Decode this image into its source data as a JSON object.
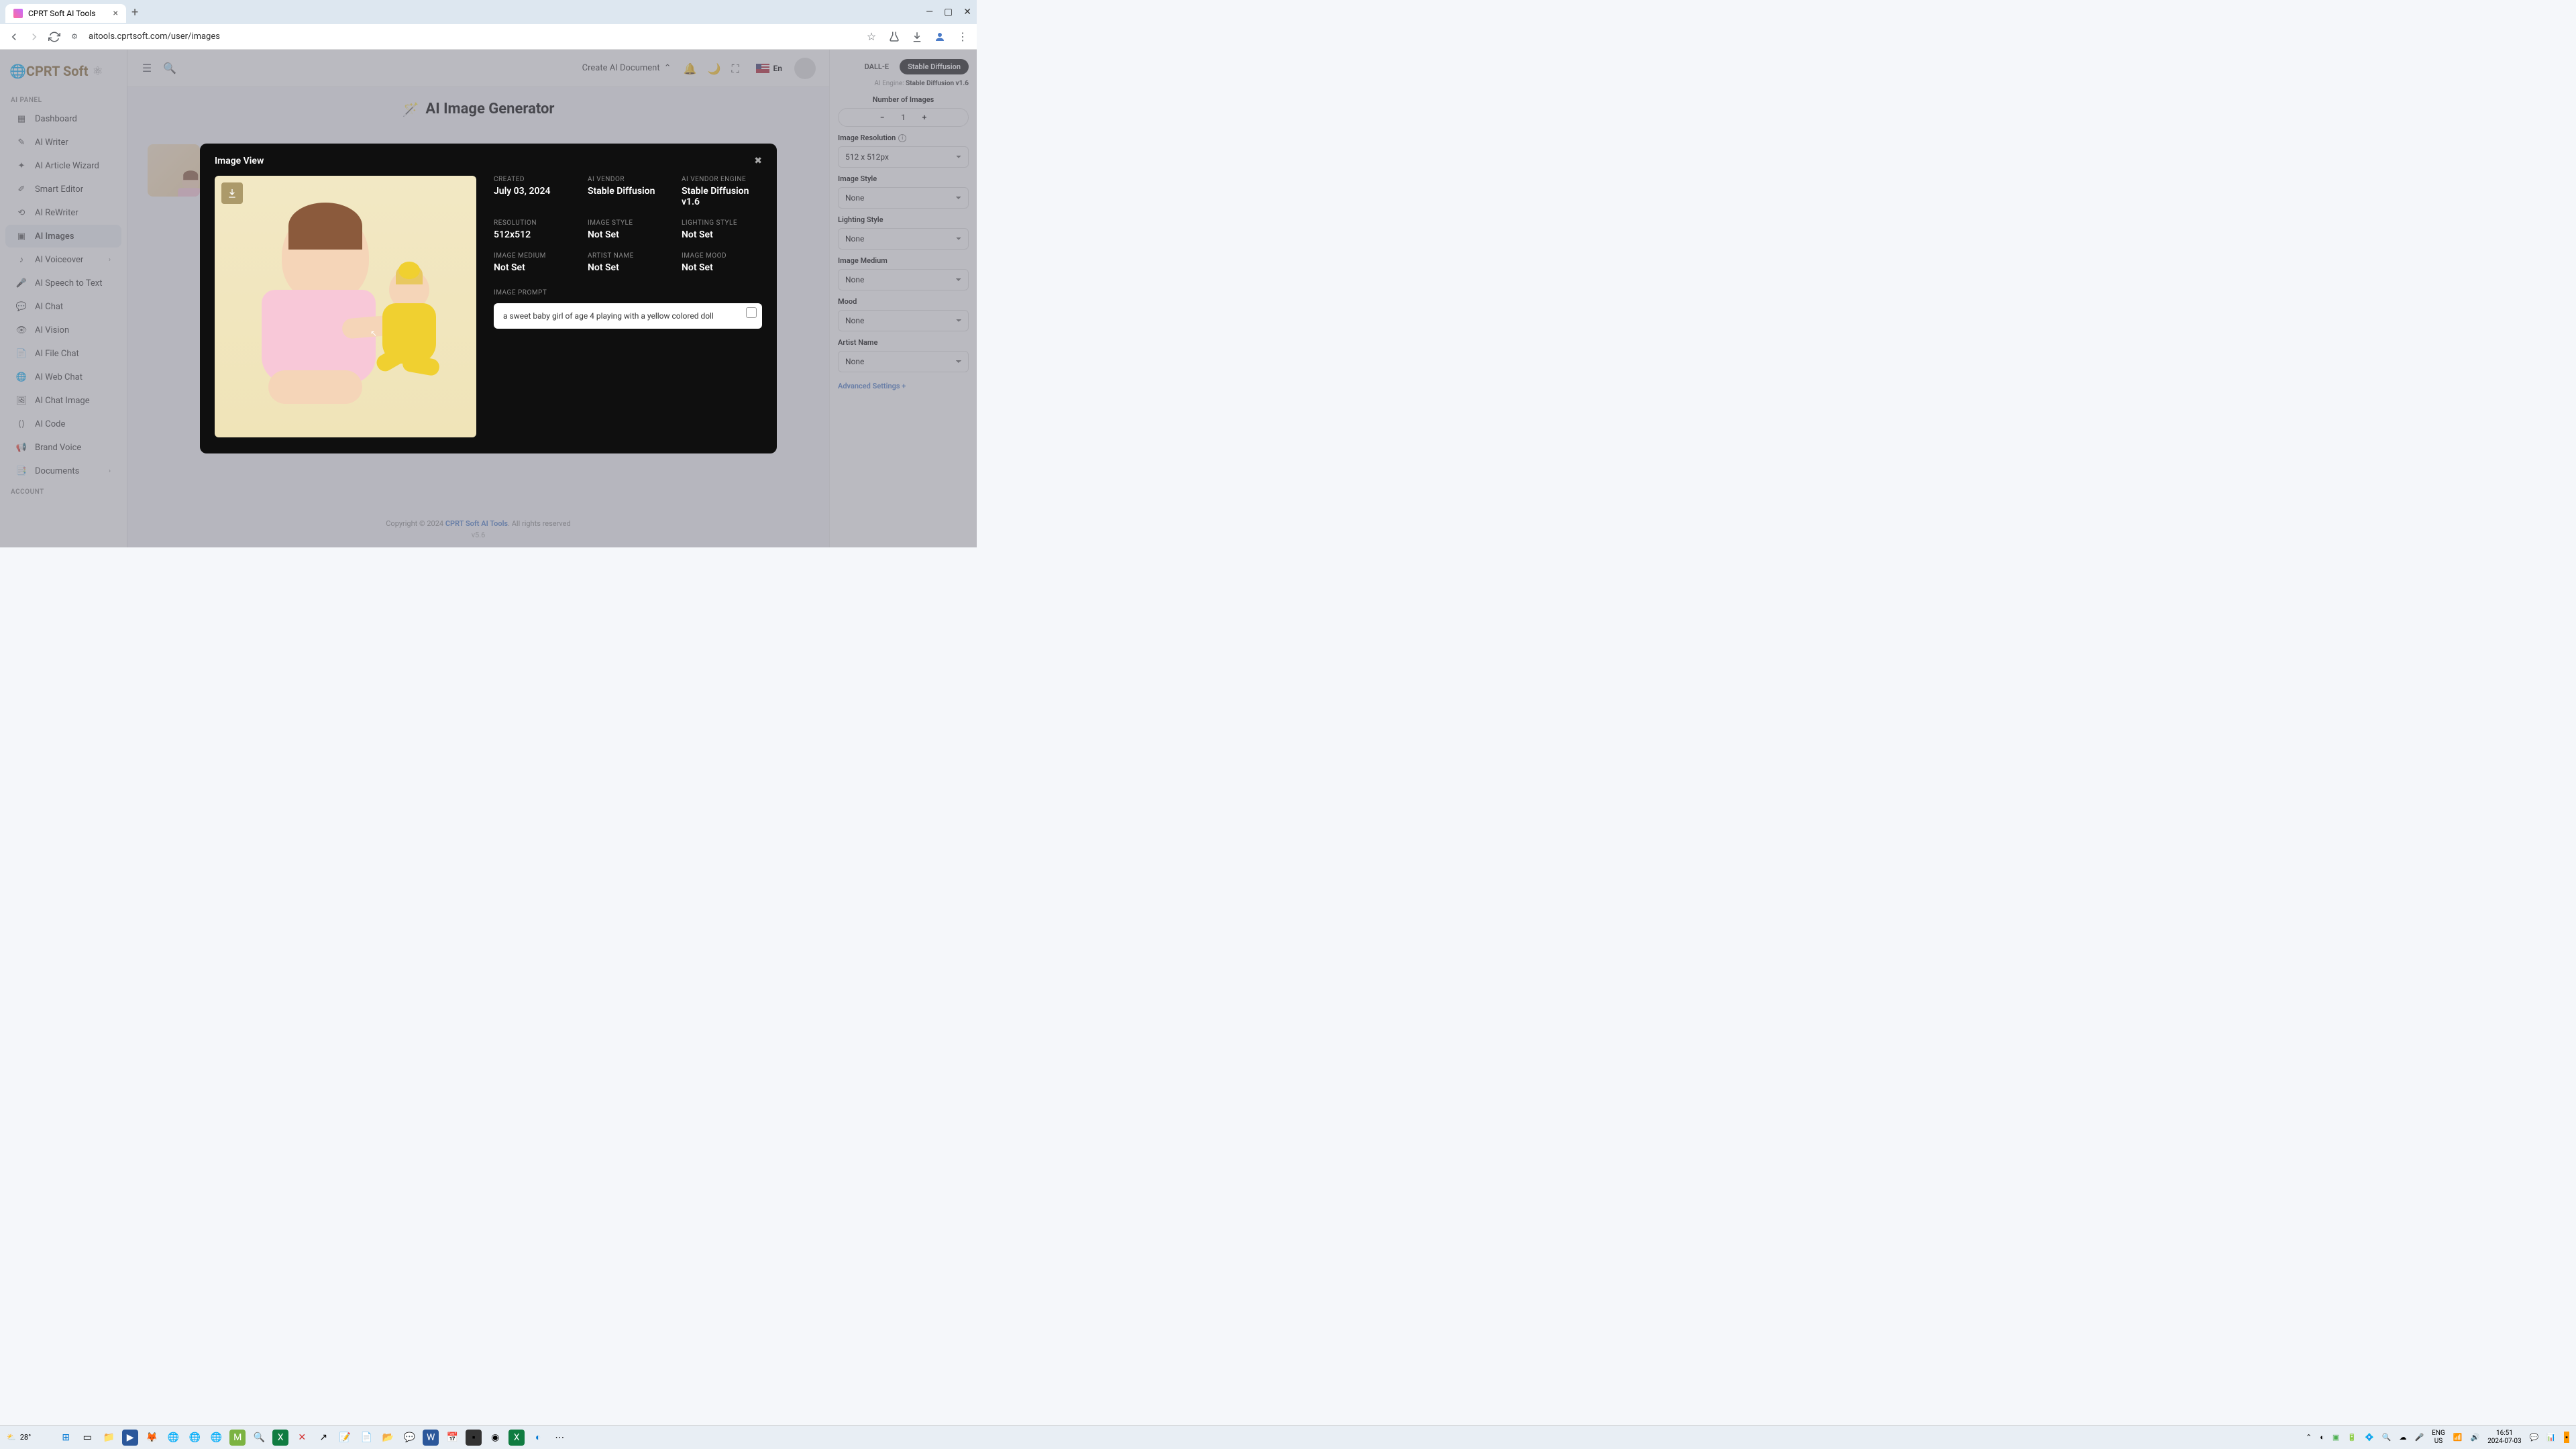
{
  "browser": {
    "tab_title": "CPRT Soft AI Tools",
    "url": "aitools.cprtsoft.com/user/images"
  },
  "logo_text": "CPRT Soft",
  "topbar": {
    "create_doc": "Create AI Document",
    "lang": "En"
  },
  "sidebar": {
    "section_ai": "AI PANEL",
    "section_account": "ACCOUNT",
    "items": [
      {
        "label": "Dashboard"
      },
      {
        "label": "AI Writer"
      },
      {
        "label": "AI Article Wizard"
      },
      {
        "label": "Smart Editor"
      },
      {
        "label": "AI ReWriter"
      },
      {
        "label": "AI Images"
      },
      {
        "label": "AI Voiceover"
      },
      {
        "label": "AI Speech to Text"
      },
      {
        "label": "AI Chat"
      },
      {
        "label": "AI Vision"
      },
      {
        "label": "AI File Chat"
      },
      {
        "label": "AI Web Chat"
      },
      {
        "label": "AI Chat Image"
      },
      {
        "label": "AI Code"
      },
      {
        "label": "Brand Voice"
      },
      {
        "label": "Documents"
      }
    ]
  },
  "page": {
    "title": "AI Image Generator"
  },
  "right": {
    "tab_dalle": "DALL-E",
    "tab_sd": "Stable Diffusion",
    "engine_prefix": "AI Engine: ",
    "engine_value": "Stable Diffusion v1.6",
    "num_label": "Number of Images",
    "num_value": "1",
    "res_label": "Image Resolution",
    "res_value": "512 x 512px",
    "style_label": "Image Style",
    "style_value": "None",
    "light_label": "Lighting Style",
    "light_value": "None",
    "medium_label": "Image Medium",
    "medium_value": "None",
    "mood_label": "Mood",
    "mood_value": "None",
    "artist_label": "Artist Name",
    "artist_value": "None",
    "adv": "Advanced Settings +"
  },
  "modal": {
    "title": "Image View",
    "meta": {
      "created_l": "CREATED",
      "created_v": "July 03, 2024",
      "vendor_l": "AI VENDOR",
      "vendor_v": "Stable Diffusion",
      "engine_l": "AI VENDOR ENGINE",
      "engine_v": "Stable Diffusion v1.6",
      "res_l": "RESOLUTION",
      "res_v": "512x512",
      "style_l": "IMAGE STYLE",
      "style_v": "Not Set",
      "light_l": "LIGHTING STYLE",
      "light_v": "Not Set",
      "medium_l": "IMAGE MEDIUM",
      "medium_v": "Not Set",
      "artist_l": "ARTIST NAME",
      "artist_v": "Not Set",
      "mood_l": "IMAGE MOOD",
      "mood_v": "Not Set"
    },
    "prompt_l": "IMAGE PROMPT",
    "prompt_v": "a sweet baby girl of age 4 playing with a yellow colored doll"
  },
  "footer": {
    "pre": "Copyright © 2024 ",
    "link": "CPRT Soft AI Tools",
    "post": ". All rights reserved",
    "ver": "v5.6"
  },
  "taskbar": {
    "temp": "28°",
    "lang1": "ENG",
    "lang2": "US",
    "time": "16:51",
    "date": "2024-07-03"
  }
}
